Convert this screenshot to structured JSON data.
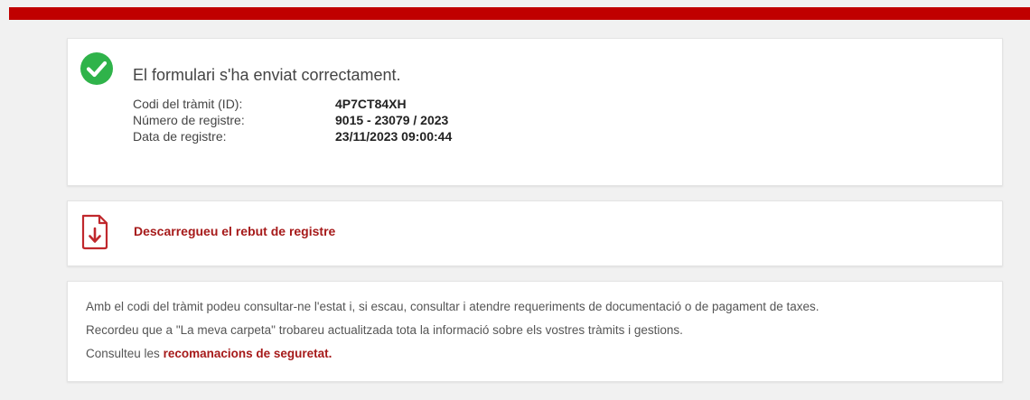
{
  "colors": {
    "brand_red": "#c00000",
    "link_red": "#a61a1a",
    "success_green": "#2fb34a"
  },
  "success": {
    "icon": "check-circle-icon",
    "title": "El formulari s'ha enviat correctament.",
    "details": [
      {
        "label": "Codi del tràmit (ID):",
        "value": "4P7CT84XH"
      },
      {
        "label": "Número de registre:",
        "value": "9015 - 23079 / 2023"
      },
      {
        "label": "Data de registre:",
        "value": "23/11/2023 09:00:44"
      }
    ]
  },
  "receipt": {
    "icon": "pdf-download-icon",
    "link_text": "Descarregueu el rebut de registre"
  },
  "info": {
    "line1": "Amb el codi del tràmit podeu consultar-ne l'estat i, si escau, consultar i atendre requeriments de documentació o de pagament de taxes.",
    "line2": "Recordeu que a \"La meva carpeta\" trobareu actualitzada tota la informació sobre els vostres tràmits i gestions.",
    "line3_prefix": "Consulteu les ",
    "line3_link": "recomanacions de seguretat."
  }
}
